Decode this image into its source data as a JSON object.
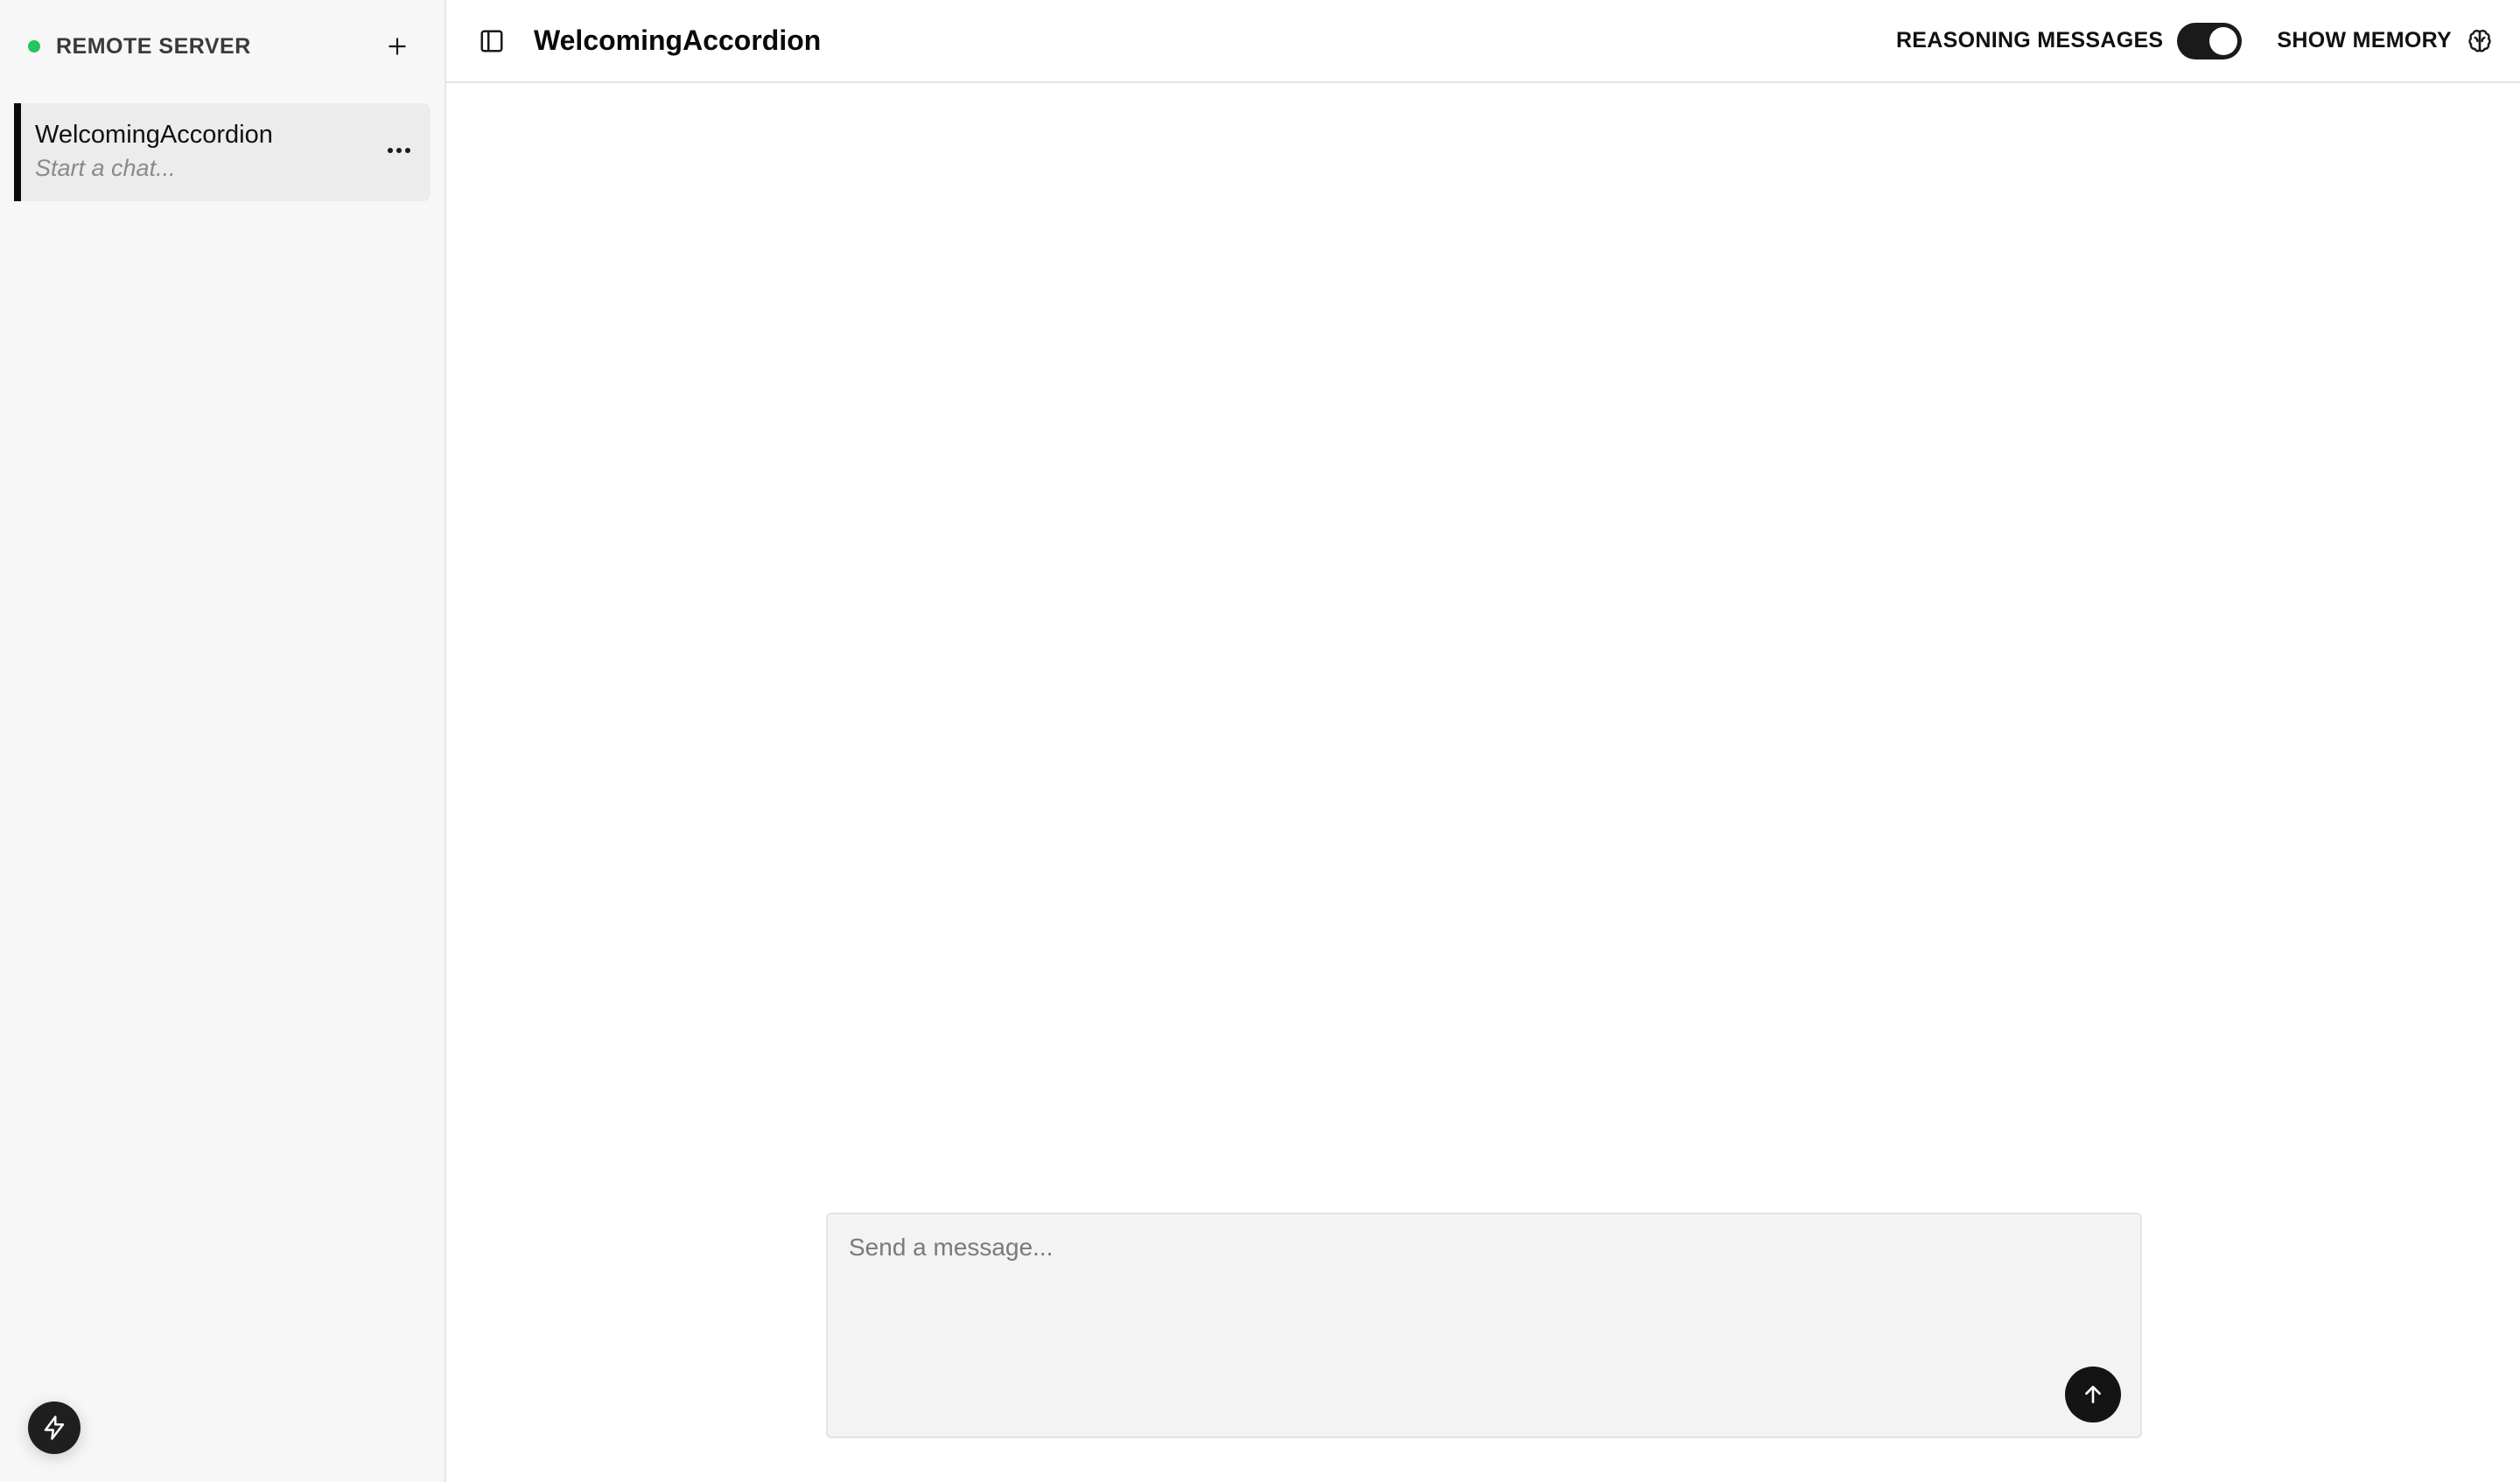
{
  "sidebar": {
    "server_status_label": "REMOTE SERVER",
    "server_status_color": "#22c55e",
    "new_chat_icon": "plus-icon",
    "chats": [
      {
        "title": "WelcomingAccordion",
        "subtitle": "Start a chat...",
        "menu_icon": "more-horizontal-icon"
      }
    ],
    "footer_icon": "lightning-icon"
  },
  "header": {
    "panel_icon": "sidebar-toggle-icon",
    "title": "WelcomingAccordion",
    "reasoning_label": "REASONING MESSAGES",
    "reasoning_enabled": true,
    "memory_label": "SHOW MEMORY",
    "memory_icon": "brain-icon"
  },
  "composer": {
    "placeholder": "Send a message...",
    "value": "",
    "send_icon": "arrow-up-icon"
  }
}
